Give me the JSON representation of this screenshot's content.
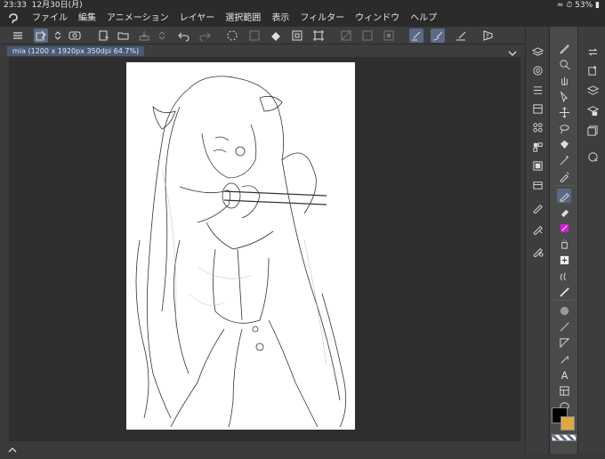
{
  "status": {
    "time": "23:33",
    "date": "12月30日(月)",
    "battery": "53%"
  },
  "menu": {
    "items": [
      "ファイル",
      "編集",
      "アニメーション",
      "レイヤー",
      "選択範囲",
      "表示",
      "フィルター",
      "ウィンドウ",
      "ヘルプ"
    ]
  },
  "tab": {
    "label": "mia (1200 x 1920px 350dpi 64.7%)"
  },
  "colors": {
    "main": "#000000",
    "sub": "#e0a840",
    "accent": "#5a6a85",
    "magenta": "#d020d0"
  },
  "toolbar_icons": [
    "menu-icon",
    "layer-select-icon",
    "stepper-icon",
    "eye-icon",
    "new-page-icon",
    "open-folder-icon",
    "save-icon",
    "stepper-icon",
    "undo-icon",
    "redo-icon",
    "spinner-icon",
    "transform-icon",
    "fill-icon",
    "crop-icon",
    "select-rect-icon",
    "hide-selection-icon",
    "deselect-icon",
    "invert-icon",
    "pen-stroke-icon",
    "brush-stroke-icon",
    "eraser-stroke-icon",
    "help-icon"
  ]
}
